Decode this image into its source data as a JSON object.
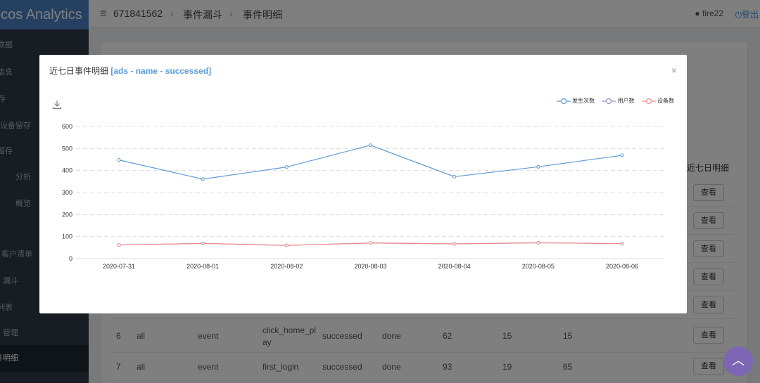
{
  "brand": "ocos Analytics",
  "sidebar": {
    "items": [
      {
        "label": "数据"
      },
      {
        "label": "信息"
      },
      {
        "label": "存"
      },
      {
        "label": "增设备留存"
      },
      {
        "label": "跃设备留存"
      },
      {
        "label": "分析"
      },
      {
        "label": "概览"
      },
      {
        "label": "客户清单"
      },
      {
        "label": "漏斗"
      },
      {
        "label": "列表"
      },
      {
        "label": "管理"
      },
      {
        "label": "件明细"
      }
    ]
  },
  "header": {
    "project_id": "671841562",
    "breadcrumb": [
      "事件漏斗",
      "事件明细"
    ],
    "user": "fire22",
    "logout": "登出"
  },
  "table": {
    "last_header": "近七日明细",
    "view_label": "查看",
    "rows": [
      {
        "n": "6",
        "scope": "all",
        "type": "event",
        "name_line1": "click_home_pl",
        "name_line2": "ay",
        "status": "successed",
        "state": "done",
        "count": "62",
        "users": "15",
        "devices": "15"
      },
      {
        "n": "7",
        "scope": "all",
        "type": "event",
        "name_line1": "first_login",
        "name_line2": "",
        "status": "successed",
        "state": "done",
        "count": "93",
        "users": "19",
        "devices": "65"
      }
    ]
  },
  "modal": {
    "title": "近七日事件明细",
    "tag": "[ads - name - successed]",
    "close": "×"
  },
  "chart_data": {
    "type": "line",
    "x": [
      "2020-07-31",
      "2020-08-01",
      "2020-08-02",
      "2020-08-03",
      "2020-08-04",
      "2020-08-05",
      "2020-08-06"
    ],
    "ylim": [
      0,
      600
    ],
    "yticks": [
      0,
      100,
      200,
      300,
      400,
      500,
      600
    ],
    "grid": true,
    "legend": "top-right",
    "series": [
      {
        "name": "发生次数",
        "color": "#5b9bd5",
        "values": [
          448,
          361,
          416,
          515,
          372,
          417,
          469
        ]
      },
      {
        "name": "用户数",
        "color": "#9b8fc9",
        "values": [
          62,
          69,
          60,
          71,
          67,
          72,
          68
        ]
      },
      {
        "name": "设备数",
        "color": "#f08b8b",
        "values": [
          62,
          69,
          60,
          71,
          67,
          72,
          68
        ]
      }
    ]
  }
}
